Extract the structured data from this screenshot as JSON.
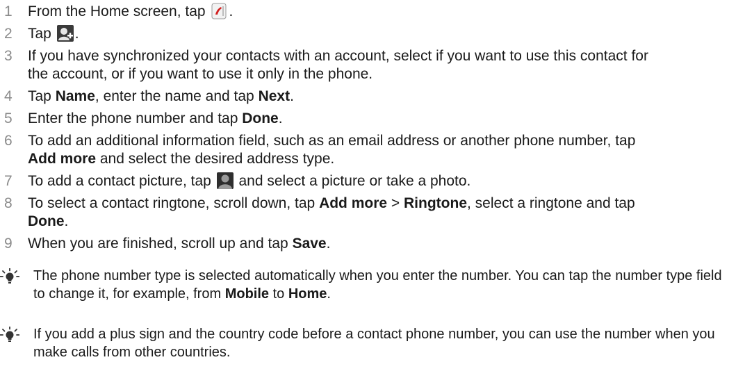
{
  "steps": [
    {
      "num": "1",
      "pre": "From the Home screen, tap ",
      "post": "."
    },
    {
      "num": "2",
      "pre": "Tap ",
      "post": "."
    },
    {
      "num": "3",
      "text": "If you have synchronized your contacts with an account, select if you want to use this contact for the account, or if you want to use it only in the phone."
    },
    {
      "num": "4",
      "a": "Tap ",
      "b1": "Name",
      "c": ", enter the name and tap ",
      "b2": "Next",
      "d": "."
    },
    {
      "num": "5",
      "a": "Enter the phone number and tap ",
      "b1": "Done",
      "d": "."
    },
    {
      "num": "6",
      "a": "To add an additional information field, such as an email address or another phone number, tap ",
      "b1": "Add more",
      "d": " and select the desired address type."
    },
    {
      "num": "7",
      "pre": "To add a contact picture, tap ",
      "post": " and select a picture or take a photo."
    },
    {
      "num": "8",
      "a": "To select a contact ringtone, scroll down, tap ",
      "b1": "Add more",
      "c": " > ",
      "b2": "Ringtone",
      "d": ", select a ringtone and tap ",
      "b3": "Done",
      "e": "."
    },
    {
      "num": "9",
      "a": "When you are finished, scroll up and tap ",
      "b1": "Save",
      "d": "."
    }
  ],
  "tips": [
    {
      "a": "The phone number type is selected automatically when you enter the number. You can tap the number type field to change it, for example, from ",
      "b1": "Mobile",
      "c": " to ",
      "b2": "Home",
      "d": "."
    },
    {
      "text": "If you add a plus sign and the country code before a contact phone number, you can use the number when you make calls from other countries."
    }
  ],
  "icons": {
    "step1": "phone-app-icon",
    "step2": "add-contact-icon",
    "step7": "contact-picture-icon",
    "tip": "lightbulb-tip-icon"
  }
}
